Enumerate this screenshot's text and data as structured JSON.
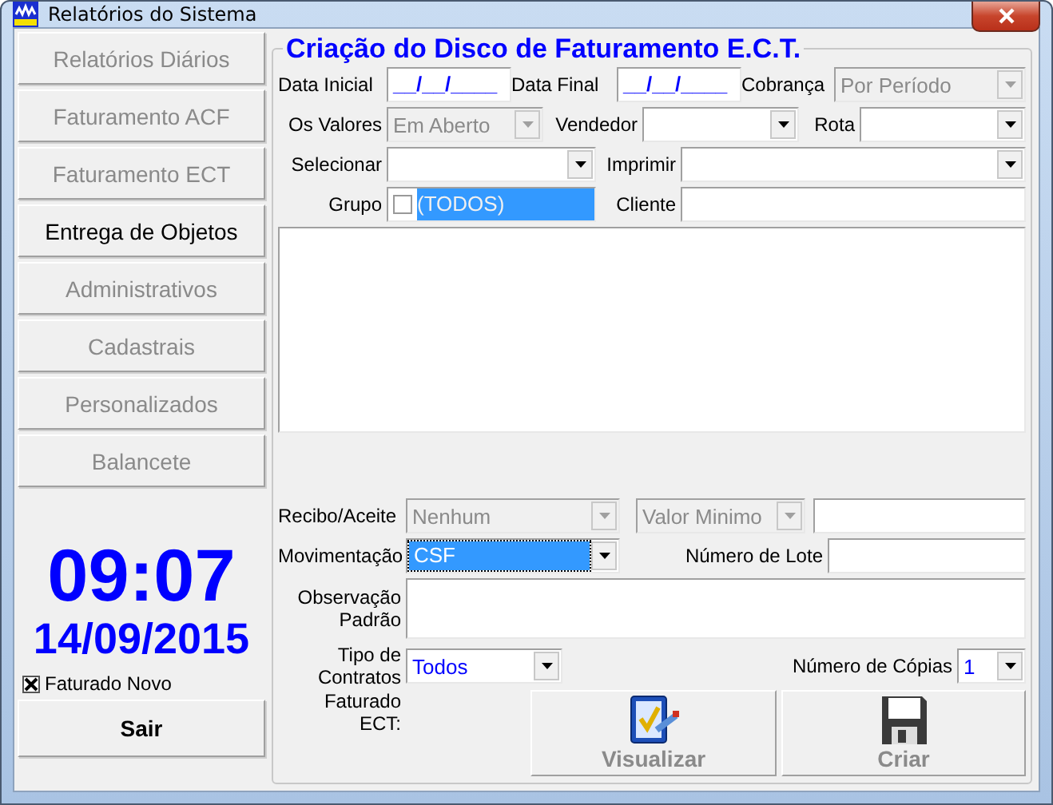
{
  "window": {
    "title": "Relatórios do Sistema"
  },
  "sidebar": {
    "buttons": [
      {
        "label": "Relatórios Diários",
        "disabled": true
      },
      {
        "label": "Faturamento ACF",
        "disabled": true
      },
      {
        "label": "Faturamento ECT",
        "disabled": true
      },
      {
        "label": "Entrega de Objetos",
        "disabled": false
      },
      {
        "label": "Administrativos",
        "disabled": true
      },
      {
        "label": "Cadastrais",
        "disabled": true
      },
      {
        "label": "Personalizados",
        "disabled": true
      },
      {
        "label": "Balancete",
        "disabled": true
      }
    ],
    "clock": {
      "time": "09:07",
      "date": "14/09/2015"
    },
    "checkbox": {
      "label": "Faturado Novo",
      "checked": true
    },
    "exit_button": "Sair"
  },
  "form": {
    "title": "Criação do Disco de Faturamento E.C.T.",
    "rows": [
      {
        "items": [
          {
            "kind": "label",
            "text": "Data Inicial"
          },
          {
            "kind": "date",
            "value": "__/__/____"
          },
          {
            "kind": "label",
            "text": "Data Final"
          },
          {
            "kind": "date",
            "value": "__/__/____"
          },
          {
            "kind": "label",
            "text": "Cobrança"
          },
          {
            "kind": "combo",
            "value": "Por Período",
            "disabled": true,
            "selected": false
          }
        ]
      },
      {
        "items": [
          {
            "kind": "label",
            "text": "Os Valores"
          },
          {
            "kind": "combo",
            "value": "Em Aberto",
            "disabled": true,
            "selected": false
          },
          {
            "kind": "label",
            "text": "Vendedor"
          },
          {
            "kind": "combo",
            "disabled": false,
            "selected": false
          },
          {
            "kind": "label",
            "text": "Rota"
          },
          {
            "kind": "combo",
            "disabled": false,
            "selected": false
          }
        ]
      },
      {
        "items": [
          {
            "kind": "label",
            "text": "Selecionar"
          },
          {
            "kind": "combo",
            "disabled": false,
            "selected": false
          },
          {
            "kind": "label",
            "text": "Imprimir"
          },
          {
            "kind": "combo",
            "disabled": false,
            "selected": false
          }
        ]
      },
      {
        "items": [
          {
            "kind": "label",
            "text": "Grupo"
          },
          {
            "kind": "checklist",
            "value": "(TODOS)",
            "checked": false,
            "selected": true
          },
          {
            "kind": "label",
            "text": "Cliente"
          },
          {
            "kind": "text"
          }
        ]
      },
      {
        "items": [
          {
            "kind": "list"
          }
        ]
      },
      {
        "items": [
          {
            "kind": "label",
            "text": "Recibo/Aceite"
          },
          {
            "kind": "combo",
            "value": "Nenhum",
            "disabled": true,
            "selected": false
          },
          {
            "kind": "combo",
            "value": "Valor Minimo",
            "disabled": true,
            "selected": false
          },
          {
            "kind": "text"
          }
        ]
      },
      {
        "items": [
          {
            "kind": "label",
            "text": "Movimentação"
          },
          {
            "kind": "combo",
            "value": "CSF",
            "disabled": false,
            "selected": true
          },
          {
            "kind": "label",
            "text": "Número de Lote"
          },
          {
            "kind": "text"
          }
        ]
      },
      {
        "items": [
          {
            "kind": "label",
            "text": "Observação Padrão"
          },
          {
            "kind": "area"
          }
        ]
      },
      {
        "items": [
          {
            "kind": "label",
            "text": "Tipo de Contratos"
          },
          {
            "kind": "combo",
            "value": "Todos",
            "disabled": false,
            "selected": false
          },
          {
            "kind": "label",
            "text": "Número de Cópias"
          },
          {
            "kind": "combo",
            "value": "1",
            "disabled": false,
            "selected": false
          }
        ]
      },
      {
        "items": [
          {
            "kind": "label",
            "text": "Faturado ECT:"
          },
          {
            "kind": "button",
            "label": "Visualizar",
            "disabled": true
          },
          {
            "kind": "button",
            "label": "Criar",
            "disabled": true
          }
        ]
      }
    ]
  }
}
